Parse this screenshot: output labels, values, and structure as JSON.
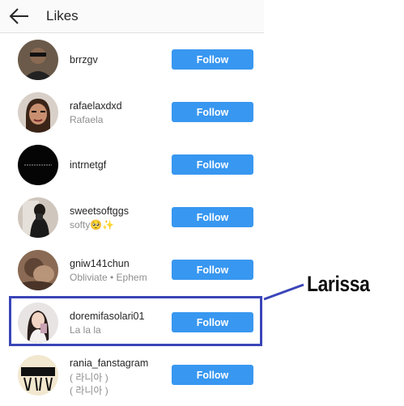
{
  "header": {
    "title": "Likes",
    "back_icon": "arrow-left-icon"
  },
  "likes": [
    {
      "username": "brrzgv",
      "subtitle": "",
      "button": "Follow",
      "avatar": "avatar-man-sunglasses"
    },
    {
      "username": "rafaelaxdxd",
      "subtitle": "Rafaela",
      "button": "Follow",
      "avatar": "avatar-cartoon-face"
    },
    {
      "username": "intrnetgf",
      "subtitle": "",
      "button": "Follow",
      "avatar": "avatar-black-text"
    },
    {
      "username": "sweetsoftggs",
      "subtitle": "softy🥺✨",
      "button": "Follow",
      "avatar": "avatar-mirror-selfie"
    },
    {
      "username": "gniw141chun",
      "subtitle": "Obliviate • Ephem",
      "button": "Follow",
      "avatar": "avatar-brown-photo"
    },
    {
      "username": "doremifasolari01",
      "subtitle": "La la la",
      "button": "Follow",
      "avatar": "avatar-girl-selfie"
    },
    {
      "username": "rania_fanstagram",
      "subtitle": "( 라니아 )",
      "subtitle2": "( 라니아 )",
      "button": "Follow",
      "avatar": "avatar-rania-logo"
    }
  ],
  "annotation": {
    "label": "Larissa",
    "color": "#3a45b8"
  },
  "colors": {
    "follow_button": "#3897f0",
    "secondary_text": "#8e8e8e",
    "highlight": "#3a45b8"
  }
}
